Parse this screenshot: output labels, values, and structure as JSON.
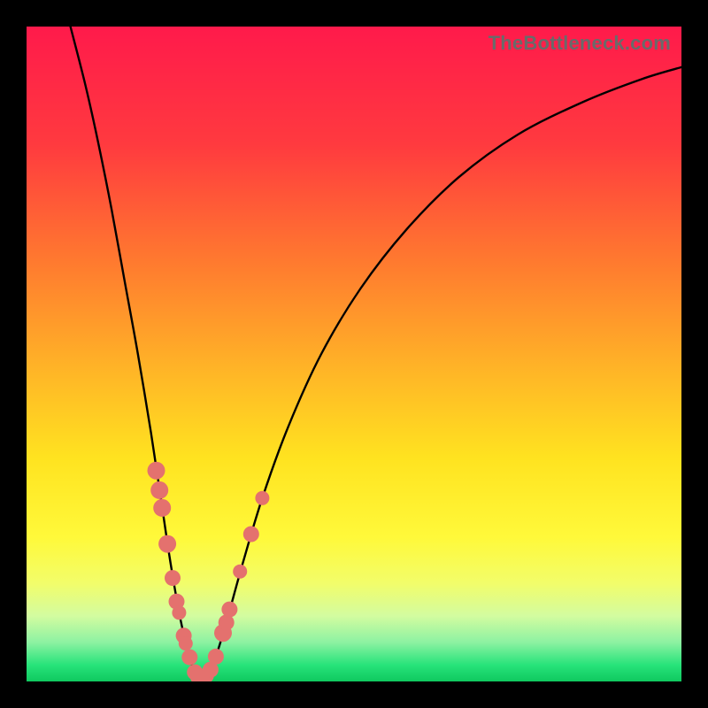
{
  "watermark": "TheBottleneck.com",
  "colors": {
    "frame": "#000000",
    "curve": "#000000",
    "marker_fill": "#e4716e",
    "marker_stroke": "#c95a58",
    "gradient_stops": [
      {
        "offset": 0.0,
        "color": "#ff1a4b"
      },
      {
        "offset": 0.18,
        "color": "#ff3a3f"
      },
      {
        "offset": 0.36,
        "color": "#ff7a2f"
      },
      {
        "offset": 0.52,
        "color": "#ffb327"
      },
      {
        "offset": 0.66,
        "color": "#ffe320"
      },
      {
        "offset": 0.78,
        "color": "#fff93a"
      },
      {
        "offset": 0.85,
        "color": "#f2fd6a"
      },
      {
        "offset": 0.9,
        "color": "#d3fca0"
      },
      {
        "offset": 0.94,
        "color": "#8df2a2"
      },
      {
        "offset": 0.975,
        "color": "#27e37a"
      },
      {
        "offset": 1.0,
        "color": "#0fc95f"
      }
    ]
  },
  "chart_data": {
    "type": "line",
    "title": "",
    "xlabel": "",
    "ylabel": "",
    "xlim": [
      0,
      1
    ],
    "ylim": [
      0,
      1
    ],
    "note": "x and y are normalized to the plot area (0..1, origin at top-left). The curve is a V-shaped bottleneck profile with its minimum near x≈0.265, y≈1.0.",
    "series_curve": {
      "name": "bottleneck-curve",
      "points": [
        {
          "x": 0.067,
          "y": 0.0
        },
        {
          "x": 0.09,
          "y": 0.09
        },
        {
          "x": 0.11,
          "y": 0.18
        },
        {
          "x": 0.13,
          "y": 0.28
        },
        {
          "x": 0.15,
          "y": 0.39
        },
        {
          "x": 0.17,
          "y": 0.5
        },
        {
          "x": 0.19,
          "y": 0.62
        },
        {
          "x": 0.205,
          "y": 0.72
        },
        {
          "x": 0.22,
          "y": 0.82
        },
        {
          "x": 0.235,
          "y": 0.905
        },
        {
          "x": 0.248,
          "y": 0.96
        },
        {
          "x": 0.258,
          "y": 0.988
        },
        {
          "x": 0.266,
          "y": 0.996
        },
        {
          "x": 0.276,
          "y": 0.99
        },
        {
          "x": 0.288,
          "y": 0.965
        },
        {
          "x": 0.305,
          "y": 0.91
        },
        {
          "x": 0.33,
          "y": 0.82
        },
        {
          "x": 0.36,
          "y": 0.72
        },
        {
          "x": 0.4,
          "y": 0.61
        },
        {
          "x": 0.45,
          "y": 0.5
        },
        {
          "x": 0.51,
          "y": 0.4
        },
        {
          "x": 0.58,
          "y": 0.31
        },
        {
          "x": 0.66,
          "y": 0.23
        },
        {
          "x": 0.75,
          "y": 0.165
        },
        {
          "x": 0.85,
          "y": 0.115
        },
        {
          "x": 0.94,
          "y": 0.08
        },
        {
          "x": 1.0,
          "y": 0.062
        }
      ]
    },
    "series_markers": {
      "name": "highlight-markers",
      "points": [
        {
          "x": 0.198,
          "y": 0.678,
          "r": 10
        },
        {
          "x": 0.203,
          "y": 0.708,
          "r": 10
        },
        {
          "x": 0.207,
          "y": 0.735,
          "r": 10
        },
        {
          "x": 0.215,
          "y": 0.79,
          "r": 10
        },
        {
          "x": 0.223,
          "y": 0.842,
          "r": 9
        },
        {
          "x": 0.229,
          "y": 0.878,
          "r": 9
        },
        {
          "x": 0.233,
          "y": 0.895,
          "r": 8
        },
        {
          "x": 0.24,
          "y": 0.93,
          "r": 9
        },
        {
          "x": 0.243,
          "y": 0.942,
          "r": 8
        },
        {
          "x": 0.249,
          "y": 0.963,
          "r": 9
        },
        {
          "x": 0.257,
          "y": 0.986,
          "r": 9
        },
        {
          "x": 0.262,
          "y": 0.993,
          "r": 9
        },
        {
          "x": 0.268,
          "y": 0.994,
          "r": 9
        },
        {
          "x": 0.274,
          "y": 0.991,
          "r": 9
        },
        {
          "x": 0.281,
          "y": 0.982,
          "r": 9
        },
        {
          "x": 0.289,
          "y": 0.962,
          "r": 9
        },
        {
          "x": 0.3,
          "y": 0.926,
          "r": 10
        },
        {
          "x": 0.305,
          "y": 0.91,
          "r": 9
        },
        {
          "x": 0.31,
          "y": 0.89,
          "r": 9
        },
        {
          "x": 0.326,
          "y": 0.832,
          "r": 8
        },
        {
          "x": 0.343,
          "y": 0.775,
          "r": 9
        },
        {
          "x": 0.36,
          "y": 0.72,
          "r": 8
        }
      ]
    }
  }
}
